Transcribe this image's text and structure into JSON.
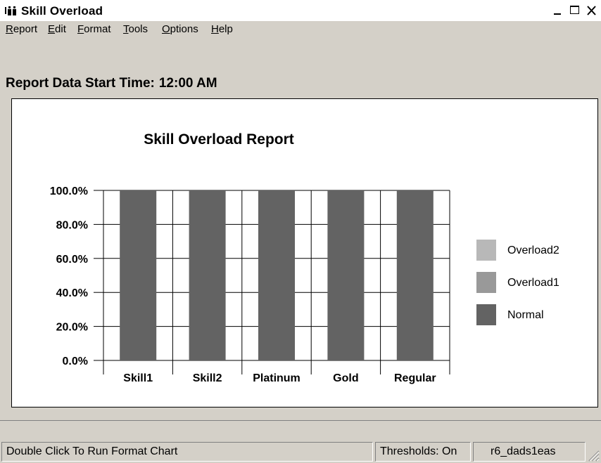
{
  "window": {
    "title": "Skill Overload",
    "controls": [
      "_",
      "☐",
      "✕"
    ]
  },
  "menu": [
    {
      "label": "Report",
      "accel": "R",
      "rest": "eport"
    },
    {
      "label": "Edit",
      "accel": "E",
      "rest": "dit"
    },
    {
      "label": "Format",
      "accel": "F",
      "rest": "ormat"
    },
    {
      "label": "Tools",
      "accel": "T",
      "rest": "ools"
    },
    {
      "label": "Options",
      "accel": "O",
      "rest": "ptions"
    },
    {
      "label": "Help",
      "accel": "H",
      "rest": "elp"
    }
  ],
  "report": {
    "start_label": "Report Data Start Time:",
    "start_time": "12:00 AM"
  },
  "chart_data": {
    "type": "bar",
    "stacked": true,
    "title": "Skill Overload Report",
    "categories": [
      "Skill1",
      "Skill2",
      "Platinum",
      "Gold",
      "Regular"
    ],
    "series": [
      {
        "name": "Normal",
        "values": [
          100,
          100,
          100,
          100,
          100
        ],
        "color": "#636363"
      },
      {
        "name": "Overload1",
        "values": [
          0,
          0,
          0,
          0,
          0
        ],
        "color": "#999999"
      },
      {
        "name": "Overload2",
        "values": [
          0,
          0,
          0,
          0,
          0
        ],
        "color": "#b8b8b8"
      }
    ],
    "legend_order": [
      "Overload2",
      "Overload1",
      "Normal"
    ],
    "ylim": [
      0,
      100
    ],
    "yticks": [
      0,
      20,
      40,
      60,
      80,
      100
    ],
    "ytick_labels": [
      "0.0%",
      "20.0%",
      "40.0%",
      "60.0%",
      "80.0%",
      "100.0%"
    ],
    "grid": true,
    "legend_position": "right"
  },
  "status": {
    "hint": "Double Click To Run Format Chart",
    "thresholds": "Thresholds: On",
    "server": "r6_dads1eas"
  }
}
